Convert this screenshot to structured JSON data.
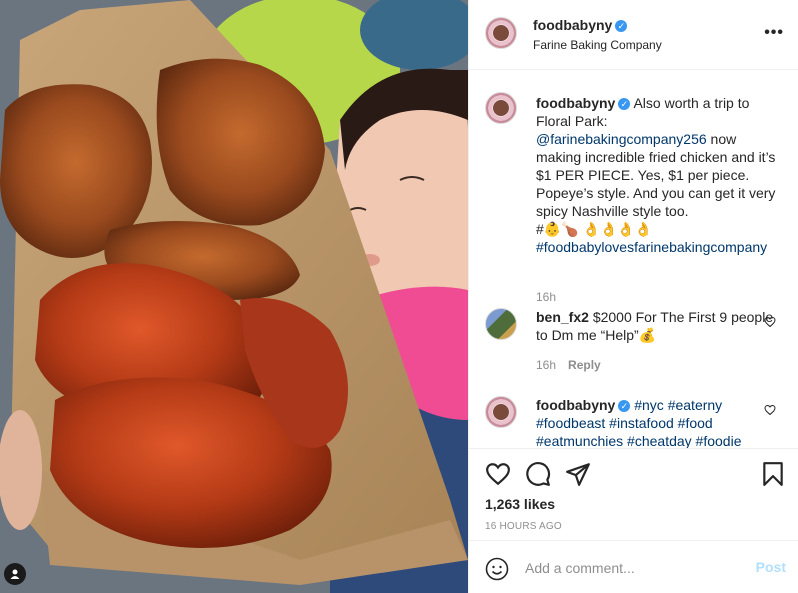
{
  "post": {
    "username": "foodbabyny",
    "verified_glyph": "✓",
    "location": "Farine Baking Company",
    "more_icon": "•••",
    "photo_description_icon": "user-tag-icon"
  },
  "caption": {
    "username": "foodbabyny",
    "text_before_link": "Also worth a trip to Floral Park: ",
    "mention": "@farinebakingcompany256",
    "text_after_link": " now making incredible fried chicken and it’s $1 PER PIECE. Yes, $1 per piece. Popeye’s style. And you can get it very spicy Nashville style too.",
    "emoji_line": "#👶🍗 👌👌👌👌",
    "hashtag": "#foodbabylovesfarinebakingcompany",
    "time": "16h"
  },
  "comments": [
    {
      "username": "ben_fx2",
      "text": "$2000 For The First 9 people to Dm me “Help”💰",
      "time": "16h",
      "reply_label": "Reply"
    },
    {
      "username": "foodbabyny",
      "text": "#nyc #eaterny #foodbeast #instafood #food #eatmunchies #cheatday #foodie"
    }
  ],
  "actions": {
    "likes": "1,263 likes",
    "time_ago": "16 HOURS AGO"
  },
  "add_comment": {
    "placeholder": "Add a comment...",
    "post_label": "Post"
  },
  "colors": {
    "verified": "#3897f0",
    "link": "#00376b",
    "muted": "#8e8e8e",
    "post_disabled": "#b2dffc"
  }
}
